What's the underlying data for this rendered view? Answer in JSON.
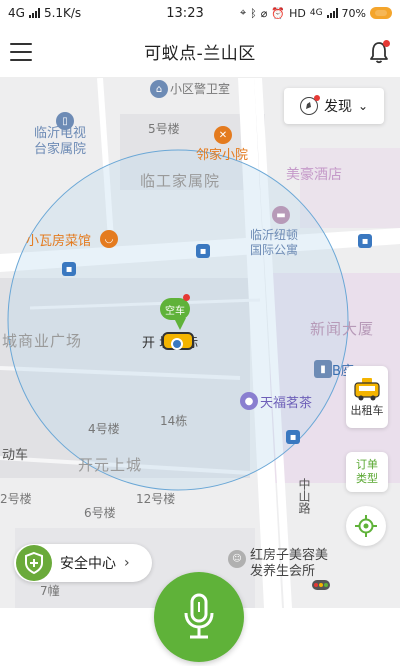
{
  "status_bar": {
    "network": "4G",
    "speed": "5.1K/s",
    "time": "13:23",
    "hd": "HD",
    "net_type": "4G",
    "battery": "70%"
  },
  "header": {
    "title": "可蚁点-兰山区"
  },
  "discover": {
    "label": "发现"
  },
  "map": {
    "labels": {
      "police": "小区警卫室",
      "tv_station": "临沂电视\n台家属院",
      "bldg5": "5号楼",
      "neighbor_yard": "邻家小院",
      "linyi_worker": "临工家属院",
      "meihao_hotel": "美豪酒店",
      "small_tile": "小瓦房菜馆",
      "newyork": "临沂纽顿\n国际公寓",
      "city_plaza": "城商业广场",
      "news_tower": "新闻大厦",
      "kaiyuan_intl": "开 城国际",
      "b_block": "B座",
      "tianfu_tea": "天福茗茶",
      "bldg4": "4号楼",
      "bldg14": "14栋",
      "kaiyuan_city": "开元上城",
      "dongche": "动车",
      "bldg2": "2号楼",
      "bldg12": "12号楼",
      "bldg6": "6号楼",
      "zhongshan_rd": "中山路",
      "beauty": "红房子美容美\n发养生会所",
      "bldg7": "7幢"
    },
    "pin_label": "空车"
  },
  "side_buttons": {
    "taxi": "出租车",
    "order_type": "订单\n类型"
  },
  "safety": {
    "label": "安全中心"
  },
  "colors": {
    "brand_green": "#5fb239",
    "alert_red": "#e53935",
    "taxi_yellow": "#f4b400"
  }
}
